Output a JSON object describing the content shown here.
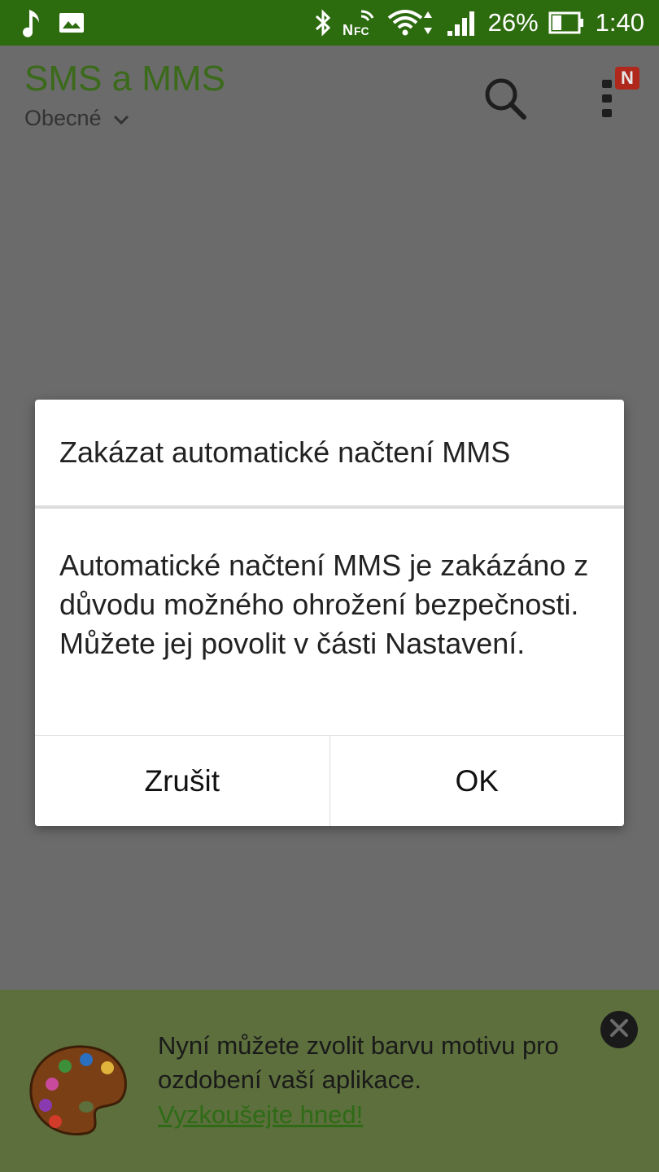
{
  "status_bar": {
    "battery_percent": "26%",
    "time": "1:40",
    "icons": [
      "music-note-icon",
      "image-icon",
      "bluetooth-icon",
      "nfc-icon",
      "wifi-icon",
      "signal-icon",
      "battery-icon"
    ]
  },
  "app_bar": {
    "title": "SMS a MMS",
    "subtitle": "Obecné",
    "menu_badge": "N"
  },
  "dialog": {
    "title": "Zakázat automatické načtení MMS",
    "message": "Automatické načtení MMS je zakázáno z důvodu možného ohrožení bezpečnosti. Můžete jej povolit v části Nastavení.",
    "cancel_label": "Zrušit",
    "ok_label": "OK"
  },
  "banner": {
    "text": "Nyní můžete zvolit barvu motivu pro ozdobení vaší aplikace.",
    "link": "Vyzkoušejte hned!"
  },
  "colors": {
    "status_bar": "#2d6b0f",
    "accent": "#3a6a1a",
    "badge": "#b0271b"
  }
}
